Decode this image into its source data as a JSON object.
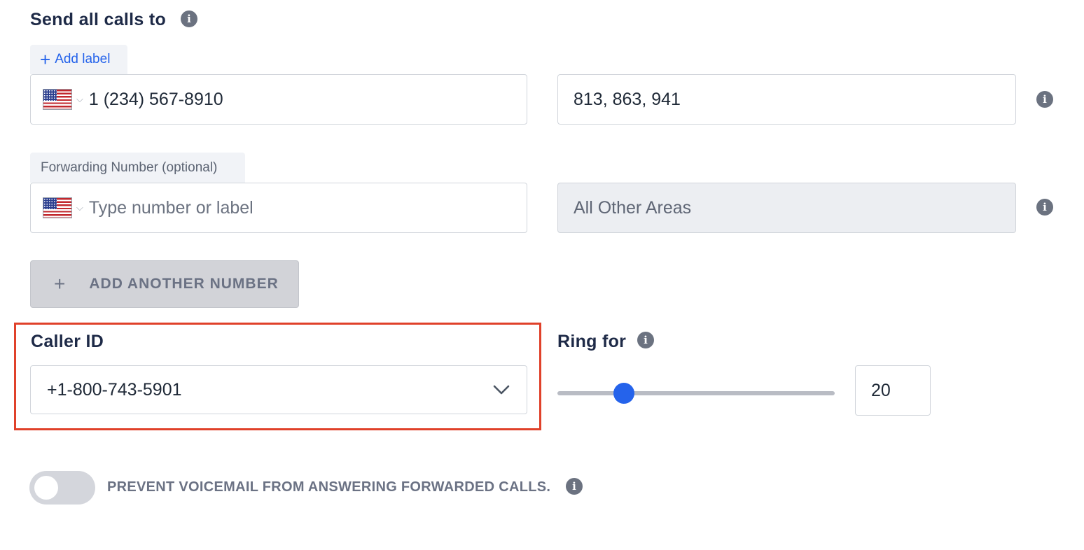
{
  "send_calls": {
    "title": "Send all calls to",
    "rows": [
      {
        "label": "Add label",
        "label_icon": "plus-icon",
        "number": "1 (234) 567-8910",
        "number_placeholder": "",
        "areas": "813, 863, 941"
      },
      {
        "label": "Forwarding Number (optional)",
        "number": "",
        "number_placeholder": "Type number or label",
        "areas": "All Other Areas"
      }
    ],
    "add_button": "ADD ANOTHER NUMBER"
  },
  "caller_id": {
    "title": "Caller ID",
    "value": "+1-800-743-5901"
  },
  "ring_for": {
    "title": "Ring for",
    "value": "20",
    "slider_fraction": 0.24
  },
  "voicemail_toggle": {
    "label": "PREVENT VOICEMAIL FROM ANSWERING FORWARDED CALLS.",
    "enabled": false
  },
  "colors": {
    "accent": "#2563eb",
    "highlight": "#e0412a",
    "info_icon": "#6b7280"
  },
  "icons": {
    "info": "i",
    "plus": "+",
    "chevron_small": "⌵"
  }
}
